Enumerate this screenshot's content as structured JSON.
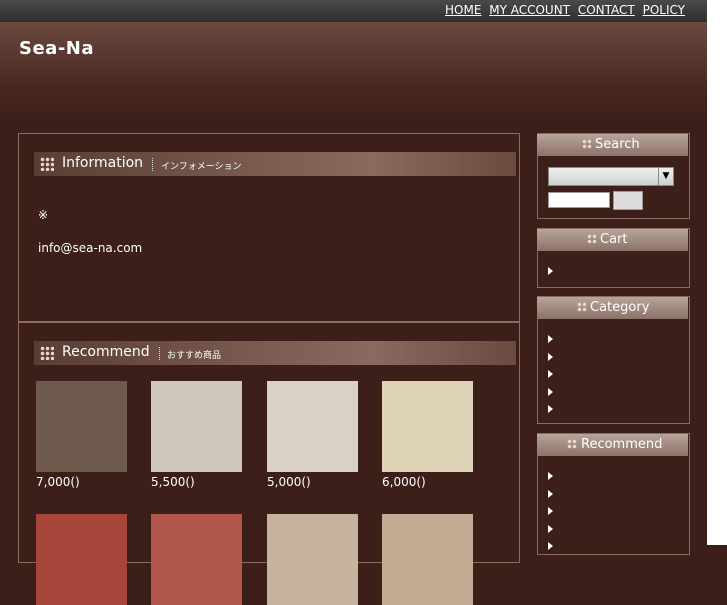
{
  "topnav": {
    "bullet": "",
    "items": [
      {
        "label": "HOME"
      },
      {
        "label": "MY ACCOUNT"
      },
      {
        "label": "CONTACT"
      },
      {
        "label": "POLICY"
      }
    ]
  },
  "header": {
    "site_title": "Sea-Na"
  },
  "information": {
    "title": "Information",
    "subtitle": "インフォメーション",
    "lines": [
      "※",
      "",
      "",
      "",
      "",
      "info@sea-na.com"
    ]
  },
  "recommend": {
    "title": "Recommend",
    "subtitle": "おすすめ商品",
    "products": [
      {
        "name": "",
        "price": "7,000()",
        "color": "#6e5a4c"
      },
      {
        "name": "",
        "price": "5,500()",
        "color": "#cfc6bd"
      },
      {
        "name": "",
        "price": "5,000()",
        "color": "#d9d2c4"
      },
      {
        "name": "",
        "price": "6,000()",
        "color": "#e0d4b8"
      },
      {
        "name": "",
        "price": "",
        "color": "#a8453a"
      },
      {
        "name": "",
        "price": "",
        "color": "#b0564a"
      },
      {
        "name": "",
        "price": "",
        "color": "#c7b49c"
      },
      {
        "name": "",
        "price": "",
        "color": "#c2ab92"
      }
    ]
  },
  "sidebar": {
    "search": {
      "title": "Search",
      "select_value": "",
      "button_label": ""
    },
    "cart": {
      "title": "Cart",
      "items": [
        {
          "label": ""
        }
      ]
    },
    "category": {
      "title": "Category",
      "items": [
        {
          "label": ""
        },
        {
          "label": ""
        },
        {
          "label": ""
        },
        {
          "label": ""
        },
        {
          "label": ""
        }
      ]
    },
    "recommend": {
      "title": "Recommend",
      "items": [
        {
          "label": ""
        },
        {
          "label": ""
        },
        {
          "label": ""
        },
        {
          "label": ""
        },
        {
          "label": ""
        }
      ]
    }
  }
}
